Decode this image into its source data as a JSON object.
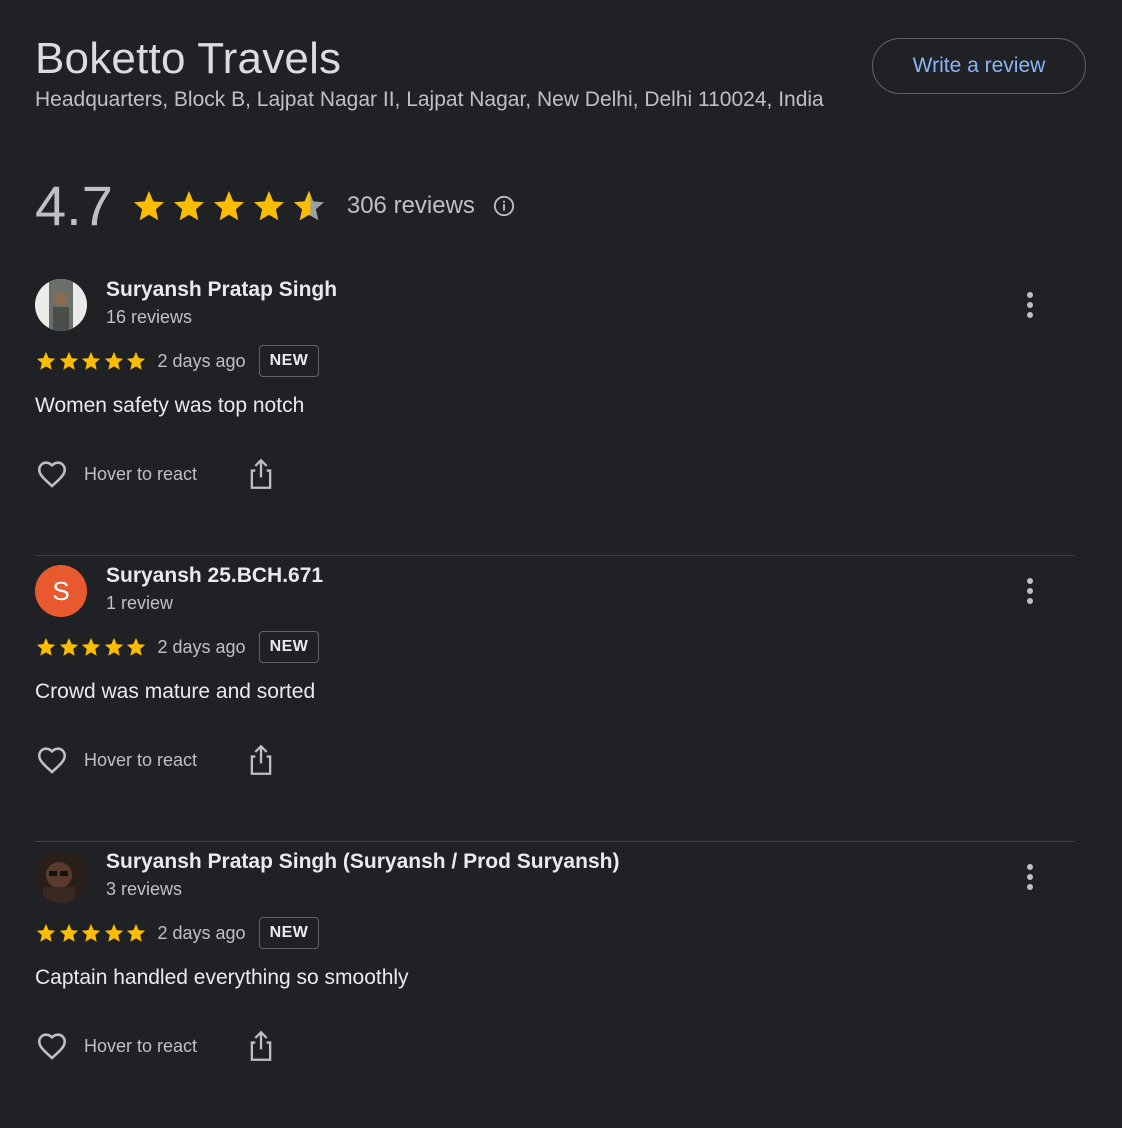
{
  "place": {
    "title": "Boketto Travels",
    "address": "Headquarters, Block B, Lajpat Nagar II, Lajpat Nagar, New Delhi, Delhi 110024, India",
    "write_review_label": "Write a review"
  },
  "summary": {
    "rating": "4.7",
    "rating_value": 4.7,
    "reviews_count": "306 reviews",
    "star_color": "#fbbc04"
  },
  "reviews": [
    {
      "name": "Suryansh Pratap Singh",
      "reviews_count": "16 reviews",
      "avatar": "photo",
      "stars": 5,
      "time": "2 days ago",
      "badge": "NEW",
      "text": "Women safety was top notch",
      "react_label": "Hover to react"
    },
    {
      "name": "Suryansh 25.BCH.671",
      "reviews_count": "1 review",
      "avatar": "letter",
      "avatar_letter": "S",
      "avatar_color": "#e8592f",
      "stars": 5,
      "time": "2 days ago",
      "badge": "NEW",
      "text": "Crowd was mature and sorted",
      "react_label": "Hover to react"
    },
    {
      "name": "Suryansh Pratap Singh (Suryansh / Prod Suryansh)",
      "reviews_count": "3 reviews",
      "avatar": "photo",
      "stars": 5,
      "time": "2 days ago",
      "badge": "NEW",
      "text": "Captain handled everything so smoothly",
      "react_label": "Hover to react"
    }
  ],
  "icons": {
    "star": "star-icon",
    "info": "info-icon",
    "more": "more-vert-icon",
    "heart": "heart-outline-icon",
    "share": "share-icon"
  }
}
